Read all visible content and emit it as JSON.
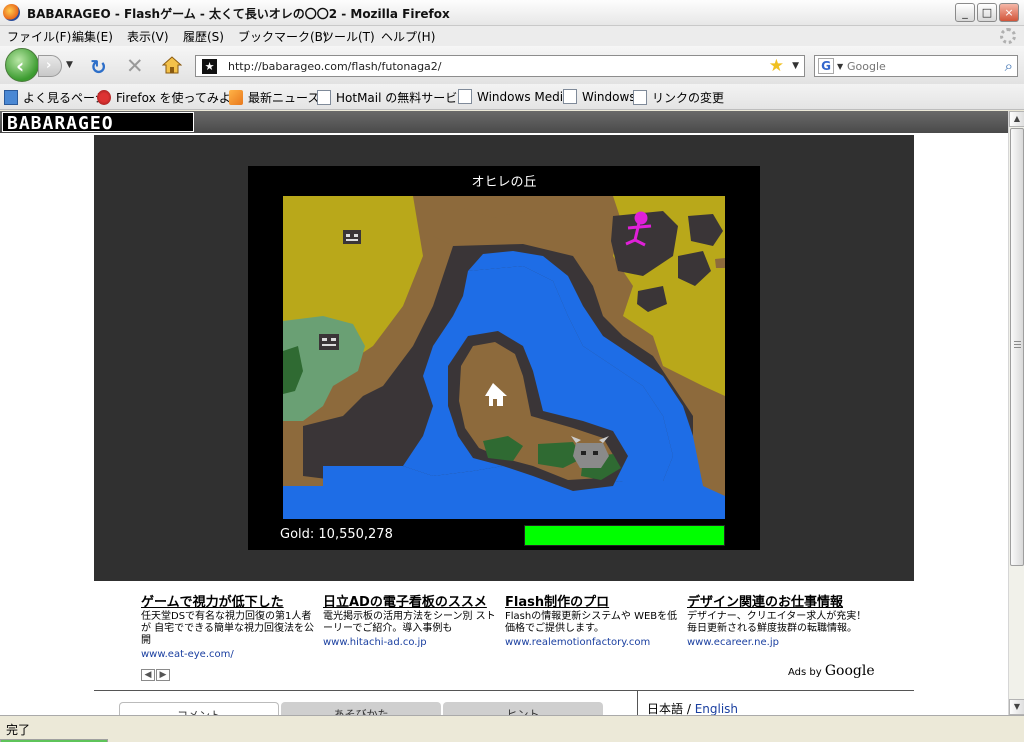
{
  "window": {
    "title": "BABARAGEO - Flashゲーム - 太くて長いオレの〇〇2 - Mozilla Firefox",
    "buttons": {
      "minimize": "_",
      "maximize": "□",
      "close": "×"
    }
  },
  "menu": {
    "items": [
      "ファイル(F)",
      "編集(E)",
      "表示(V)",
      "履歴(S)",
      "ブックマーク(B)",
      "ツール(T)",
      "ヘルプ(H)"
    ]
  },
  "nav": {
    "url": "http://babarageo.com/flash/futonaga2/",
    "search_placeholder": "Google"
  },
  "bookmarks": {
    "items": [
      {
        "label": "よく見るページ",
        "icon": "bookmark-folder-icon"
      },
      {
        "label": "Firefox を使ってみよう",
        "icon": "firefox-icon"
      },
      {
        "label": "最新ニュース",
        "icon": "rss-icon"
      },
      {
        "label": "HotMail の無料サービス",
        "icon": "page-icon"
      },
      {
        "label": "Windows Media",
        "icon": "page-icon"
      },
      {
        "label": "Windows",
        "icon": "page-icon"
      },
      {
        "label": "リンクの変更",
        "icon": "page-icon"
      }
    ]
  },
  "site": {
    "logo": "BABARAGEO"
  },
  "game": {
    "map_title": "オヒレの丘",
    "gold_label": "Gold: 10,550,278",
    "hp_fraction": 1.0,
    "colors": {
      "sand": "#b9a81a",
      "dirt": "#8d6a3c",
      "rock": "#3a3537",
      "water": "#1e6de6",
      "grass": "#6aa074",
      "forest": "#2f6a32",
      "hp": "#00ff00"
    }
  },
  "ads": [
    {
      "title": "ゲームで視力が低下した",
      "desc": "任天堂DSで有名な視力回復の第1人者が 自宅でできる簡単な視力回復法を公開",
      "url": "www.eat-eye.com/"
    },
    {
      "title": "日立ADの電子看板のススメ",
      "desc": "電光掲示板の活用方法をシーン別 ストーリーでご紹介。導入事例も",
      "url": "www.hitachi-ad.co.jp"
    },
    {
      "title": "Flash制作のプロ",
      "desc": "Flashの情報更新システムや WEBを低価格でご提供します。",
      "url": "www.realemotionfactory.com"
    },
    {
      "title": "デザイン関連のお仕事情報",
      "desc": "デザイナー、クリエイター求人が充実！毎日更新される鮮度抜群の転職情報。",
      "url": "www.ecareer.ne.jp"
    }
  ],
  "ads_by": {
    "prefix": "Ads by",
    "brand": "Google"
  },
  "tabs": [
    "コメント",
    "あそびかた",
    "ヒント"
  ],
  "lang": {
    "ja": "日本語",
    "sep": " / ",
    "en": "English"
  },
  "status": "完了"
}
